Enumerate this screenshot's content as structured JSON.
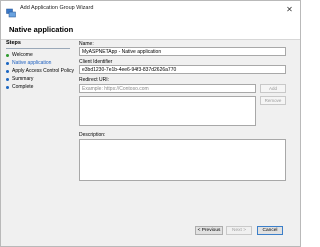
{
  "window": {
    "title": "Add Application Group Wizard",
    "close_glyph": "✕"
  },
  "header": {
    "page_title": "Native application"
  },
  "steps": {
    "title": "Steps",
    "items": [
      {
        "label": "Welcome",
        "status": "done",
        "dot_color": "#2e9b2e"
      },
      {
        "label": "Native application",
        "status": "current",
        "dot_color": "#1a66c2"
      },
      {
        "label": "Apply Access Control Policy",
        "status": "pending",
        "dot_color": "#1a66c2"
      },
      {
        "label": "Summary",
        "status": "pending",
        "dot_color": "#1a66c2"
      },
      {
        "label": "Complete",
        "status": "pending",
        "dot_color": "#1a66c2"
      }
    ]
  },
  "form": {
    "name_label": "Name:",
    "name_value": "MyASPNETApp - Native application",
    "client_id_label": "Client Identifier",
    "client_id_value": "e3bd1230-7e1b-4ee6-94f3-837d2626a770",
    "redirect_label": "Redirect URI:",
    "redirect_placeholder": "Example: https://Contoso.com",
    "add_label": "Add",
    "remove_label": "Remove",
    "description_label": "Description:",
    "description_value": ""
  },
  "footer": {
    "previous_label": "< Previous",
    "next_label": "Next >",
    "cancel_label": "Cancel"
  }
}
